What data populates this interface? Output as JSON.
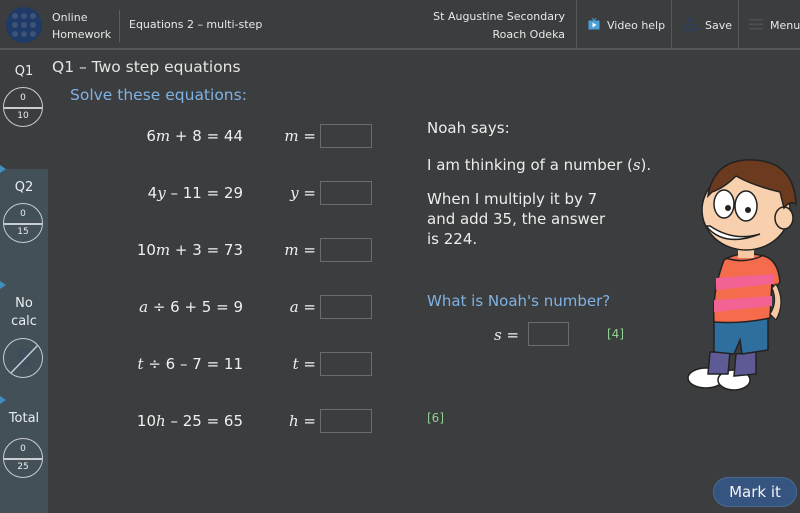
{
  "header": {
    "brand_line1": "Online",
    "brand_line2": "Homework",
    "assignment": "Equations 2 – multi-step",
    "school": "St Augustine Secondary",
    "student": "Roach Odeka",
    "buttons": {
      "video_help": {
        "label": "Video help",
        "icon": "video-icon"
      },
      "save": {
        "label": "Save",
        "icon": "upload-icon"
      },
      "menu": {
        "label": "Menu",
        "icon": "hamburger-icon"
      }
    }
  },
  "sidebar": {
    "q1": {
      "label": "Q1",
      "score": "0",
      "max": "10"
    },
    "q2": {
      "label": "Q2",
      "score": "0",
      "max": "15"
    },
    "nocalc": {
      "line1": "No",
      "line2": "calc",
      "icon": "no-calculator-icon"
    },
    "total": {
      "label": "Total",
      "score": "0",
      "max": "25"
    }
  },
  "question": {
    "title": "Q1 – Two step equations",
    "instruction": "Solve these equations:",
    "equations": [
      {
        "coef": "6",
        "var": "m",
        "rest": " + 8 = 44",
        "pre": "",
        "answer_var": "m",
        "value": ""
      },
      {
        "coef": "4",
        "var": "y",
        "rest": " – 11 = 29",
        "pre": "",
        "answer_var": "y",
        "value": ""
      },
      {
        "coef": "10",
        "var": "m",
        "rest": " + 3 = 73",
        "pre": "",
        "answer_var": "m",
        "value": ""
      },
      {
        "coef": "",
        "var": "a",
        "rest": " ÷ 6 + 5 = 9",
        "pre": "",
        "answer_var": "a",
        "value": ""
      },
      {
        "coef": "",
        "var": "t",
        "rest": " ÷ 6 – 7 = 11",
        "pre": "",
        "answer_var": "t",
        "value": ""
      },
      {
        "coef": "10",
        "var": "h",
        "rest": " – 25 = 65",
        "pre": "",
        "answer_var": "h",
        "value": ""
      }
    ],
    "equals": "=",
    "marks_left": "[6]"
  },
  "word_problem": {
    "speaker": "Noah says:",
    "line1_pre": "I am thinking of a number (",
    "line1_var": "s",
    "line1_post": ").",
    "line2": "When I multiply it by 7",
    "line3": "and add 35, the answer",
    "line4": "is 224.",
    "prompt": "What is Noah's number?",
    "answer_var": "s",
    "equals": "=",
    "value": "",
    "marks": "[4]"
  },
  "footer": {
    "mark_button": "Mark it"
  }
}
